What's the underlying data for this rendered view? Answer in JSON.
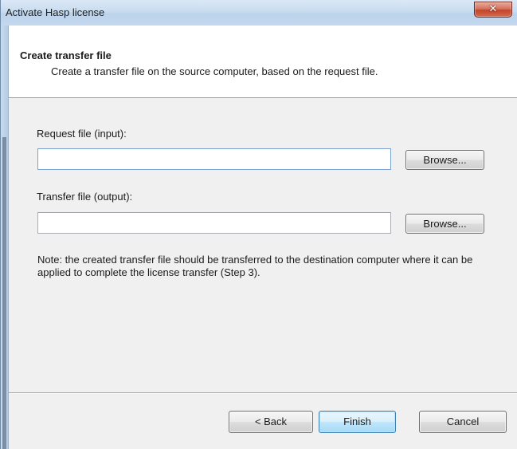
{
  "window": {
    "title": "Activate Hasp license",
    "close_icon": "close-icon"
  },
  "header": {
    "title": "Create transfer file",
    "subtitle": "Create a transfer file on the source computer, based on the request file."
  },
  "form": {
    "request_label": "Request file (input):",
    "request_value": "",
    "request_browse": "Browse...",
    "transfer_label": "Transfer file (output):",
    "transfer_value": "",
    "transfer_browse": "Browse..."
  },
  "note": "Note: the created transfer file should be transferred to the destination computer where it can be applied to complete the license transfer (Step 3).",
  "footer": {
    "back_label": "< Back",
    "finish_label": "Finish",
    "cancel_label": "Cancel"
  }
}
